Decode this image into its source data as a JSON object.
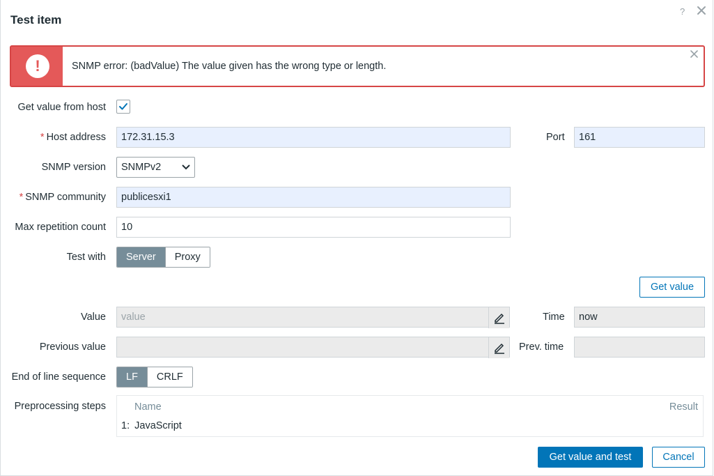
{
  "dialog": {
    "title": "Test item",
    "help_icon": "?"
  },
  "alert": {
    "icon_glyph": "!",
    "message": "SNMP error: (badValue) The value given has the wrong type or length.",
    "color": "#e45959"
  },
  "form": {
    "get_value_from_host": {
      "label": "Get value from host",
      "checked": true
    },
    "host_address": {
      "label": "Host address",
      "value": "172.31.15.3",
      "required": "*"
    },
    "port": {
      "label": "Port",
      "value": "161"
    },
    "snmp_version": {
      "label": "SNMP version",
      "selected": "SNMPv2"
    },
    "snmp_community": {
      "label": "SNMP community",
      "value": "publicesxi1",
      "required": "*"
    },
    "max_repetition": {
      "label": "Max repetition count",
      "value": "10"
    },
    "test_with": {
      "label": "Test with",
      "options": [
        "Server",
        "Proxy"
      ],
      "selected": "Server"
    },
    "get_value_button": "Get value",
    "value": {
      "label": "Value",
      "placeholder": "value"
    },
    "time": {
      "label": "Time",
      "value": "now"
    },
    "previous_value": {
      "label": "Previous value",
      "value": ""
    },
    "prev_time": {
      "label": "Prev. time",
      "value": ""
    },
    "eol": {
      "label": "End of line sequence",
      "options": [
        "LF",
        "CRLF"
      ],
      "selected": "LF"
    },
    "preprocessing": {
      "label": "Preprocessing steps",
      "columns": {
        "name": "Name",
        "result": "Result"
      },
      "steps": [
        {
          "index": "1:",
          "name": "JavaScript"
        }
      ]
    }
  },
  "footer": {
    "test_button": "Get value and test",
    "cancel_button": "Cancel"
  },
  "colors": {
    "primary": "#0275b8",
    "active_toggle": "#768d99",
    "error": "#d64545"
  }
}
